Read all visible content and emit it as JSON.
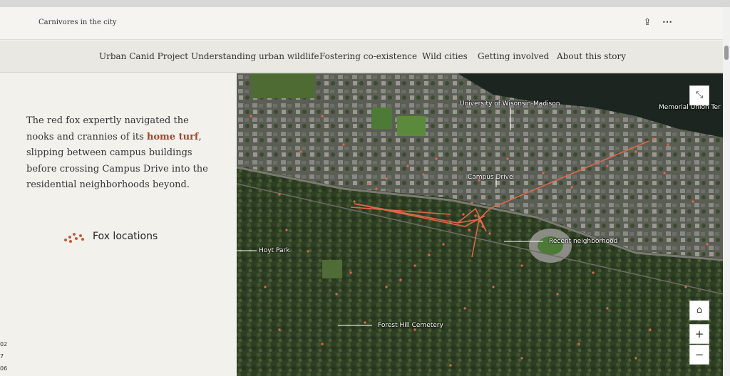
{
  "header": {
    "title": "Carnivores in the city",
    "share_icon": "share-icon",
    "more_icon": "more-icon"
  },
  "nav": {
    "items": [
      {
        "label": "Urban Canid Project"
      },
      {
        "label": "Understanding urban wildlife"
      },
      {
        "label": "Fostering co-existence"
      },
      {
        "label": "Wild cities"
      },
      {
        "label": "Getting involved"
      },
      {
        "label": "About this story"
      }
    ]
  },
  "narrative": {
    "text_before": "The red fox expertly navigated the nooks and crannies of its ",
    "link": "home turf",
    "text_after": ", slipping between campus buildings before crossing Campus Drive into the residential neighborhoods beyond."
  },
  "legend": {
    "label": "Fox locations",
    "color": "#c8583a"
  },
  "edge_numbers": [
    "02",
    "7",
    "06"
  ],
  "map": {
    "labels": {
      "university": "University of Wisonsin-Madison",
      "memorial": "Memorial Union Ter",
      "campus_drive": "Campus Drive",
      "recent": "Recent neighborhood",
      "hoyt": "Hoyt Park",
      "forest": "Forest Hill Cemetery"
    },
    "buttons": {
      "expand": "expand-icon",
      "home": "home-icon",
      "zoom_in": "+",
      "zoom_out": "−"
    },
    "track_color": "#e0694a"
  }
}
